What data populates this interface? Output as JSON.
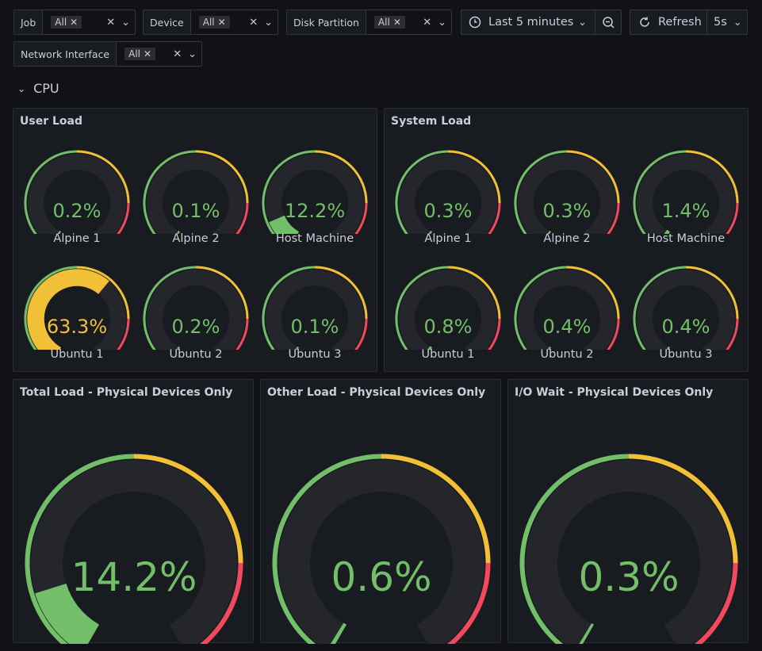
{
  "colors": {
    "green": "#73bf69",
    "yellow": "#f2c037",
    "red": "#f2495c",
    "track": "#25262c"
  },
  "variables": {
    "job": {
      "label": "Job",
      "value": "All"
    },
    "device": {
      "label": "Device",
      "value": "All"
    },
    "disk": {
      "label": "Disk Partition",
      "value": "All"
    },
    "net": {
      "label": "Network Interface",
      "value": "All"
    }
  },
  "toolbar": {
    "time_range": "Last 5 minutes",
    "refresh_label": "Refresh",
    "refresh_interval": "5s"
  },
  "row": {
    "title": "CPU"
  },
  "panels": {
    "user_load": {
      "title": "User Load",
      "gauges": [
        {
          "name": "Alpine 1",
          "value": 0.2,
          "display": "0.2%"
        },
        {
          "name": "Alpine 2",
          "value": 0.1,
          "display": "0.1%"
        },
        {
          "name": "Host Machine",
          "value": 12.2,
          "display": "12.2%"
        },
        {
          "name": "Ubuntu 1",
          "value": 63.3,
          "display": "63.3%"
        },
        {
          "name": "Ubuntu 2",
          "value": 0.2,
          "display": "0.2%"
        },
        {
          "name": "Ubuntu 3",
          "value": 0.1,
          "display": "0.1%"
        }
      ]
    },
    "system_load": {
      "title": "System Load",
      "gauges": [
        {
          "name": "Alpine 1",
          "value": 0.3,
          "display": "0.3%"
        },
        {
          "name": "Alpine 2",
          "value": 0.3,
          "display": "0.3%"
        },
        {
          "name": "Host Machine",
          "value": 1.4,
          "display": "1.4%"
        },
        {
          "name": "Ubuntu 1",
          "value": 0.8,
          "display": "0.8%"
        },
        {
          "name": "Ubuntu 2",
          "value": 0.4,
          "display": "0.4%"
        },
        {
          "name": "Ubuntu 3",
          "value": 0.4,
          "display": "0.4%"
        }
      ]
    },
    "total_load": {
      "title": "Total Load - Physical Devices Only",
      "value": 14.2,
      "display": "14.2%"
    },
    "other_load": {
      "title": "Other Load - Physical Devices Only",
      "value": 0.6,
      "display": "0.6%"
    },
    "io_wait": {
      "title": "I/O Wait - Physical Devices Only",
      "value": 0.3,
      "display": "0.3%"
    }
  }
}
